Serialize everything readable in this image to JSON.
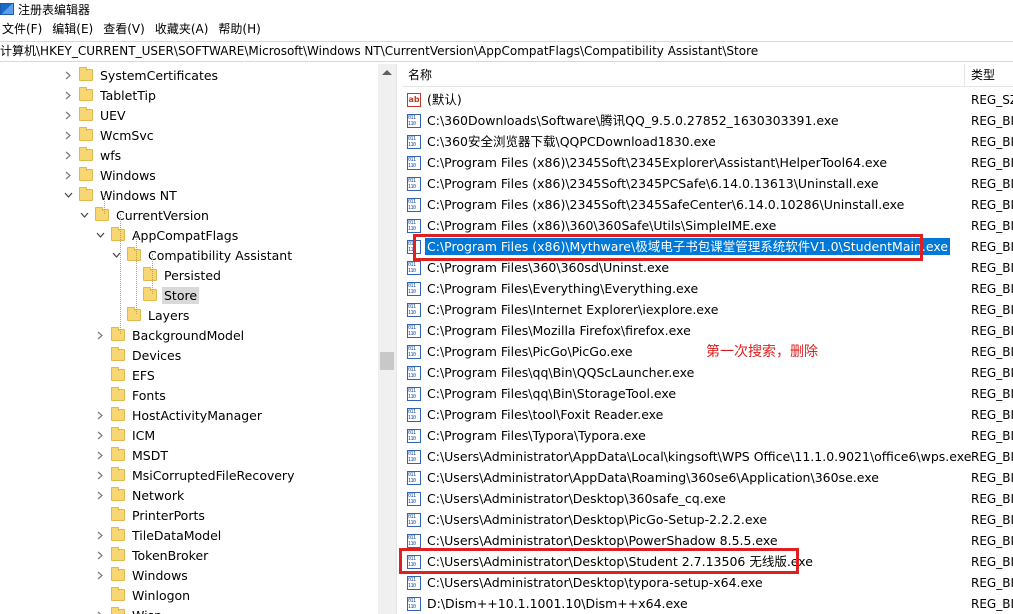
{
  "window": {
    "title": "注册表编辑器"
  },
  "menu": [
    "文件(F)",
    "编辑(E)",
    "查看(V)",
    "收藏夹(A)",
    "帮助(H)"
  ],
  "address": "计算机\\HKEY_CURRENT_USER\\SOFTWARE\\Microsoft\\Windows NT\\CurrentVersion\\AppCompatFlags\\Compatibility Assistant\\Store",
  "tree": [
    {
      "label": "SystemCertificates",
      "expander": "right"
    },
    {
      "label": "TabletTip",
      "expander": "right"
    },
    {
      "label": "UEV",
      "expander": "right"
    },
    {
      "label": "WcmSvc",
      "expander": "right"
    },
    {
      "label": "wfs",
      "expander": "right"
    },
    {
      "label": "Windows",
      "expander": "right"
    },
    {
      "label": "Windows NT",
      "expander": "down"
    },
    {
      "label": "CurrentVersion",
      "expander": "down"
    },
    {
      "label": "AppCompatFlags",
      "expander": "down"
    },
    {
      "label": "Compatibility Assistant",
      "expander": "down"
    },
    {
      "label": "Persisted",
      "expander": "none"
    },
    {
      "label": "Store",
      "expander": "none",
      "selected": true
    },
    {
      "label": "Layers",
      "expander": "none"
    },
    {
      "label": "BackgroundModel",
      "expander": "right"
    },
    {
      "label": "Devices",
      "expander": "none"
    },
    {
      "label": "EFS",
      "expander": "none"
    },
    {
      "label": "Fonts",
      "expander": "none"
    },
    {
      "label": "HostActivityManager",
      "expander": "right"
    },
    {
      "label": "ICM",
      "expander": "right"
    },
    {
      "label": "MSDT",
      "expander": "right"
    },
    {
      "label": "MsiCorruptedFileRecovery",
      "expander": "right"
    },
    {
      "label": "Network",
      "expander": "right"
    },
    {
      "label": "PrinterPorts",
      "expander": "none"
    },
    {
      "label": "TileDataModel",
      "expander": "right"
    },
    {
      "label": "TokenBroker",
      "expander": "right"
    },
    {
      "label": "Windows",
      "expander": "right"
    },
    {
      "label": "Winlogon",
      "expander": "none"
    },
    {
      "label": "Wisp",
      "expander": "right"
    }
  ],
  "list": {
    "columns": {
      "name": "名称",
      "type": "类型"
    },
    "rows": [
      {
        "name": "(默认)",
        "type": "REG_SZ",
        "icon": "ab"
      },
      {
        "name": "C:\\360Downloads\\Software\\腾讯QQ_9.5.0.27852_1630303391.exe",
        "type": "REG_BI",
        "icon": "bin"
      },
      {
        "name": "C:\\360安全浏览器下载\\QQPCDownload1830.exe",
        "type": "REG_BI",
        "icon": "bin"
      },
      {
        "name": "C:\\Program Files (x86)\\2345Soft\\2345Explorer\\Assistant\\HelperTool64.exe",
        "type": "REG_BI",
        "icon": "bin"
      },
      {
        "name": "C:\\Program Files (x86)\\2345Soft\\2345PCSafe\\6.14.0.13613\\Uninstall.exe",
        "type": "REG_BI",
        "icon": "bin"
      },
      {
        "name": "C:\\Program Files (x86)\\2345Soft\\2345SafeCenter\\6.14.0.10286\\Uninstall.exe",
        "type": "REG_BI",
        "icon": "bin"
      },
      {
        "name": "C:\\Program Files (x86)\\360\\360Safe\\Utils\\SimpleIME.exe",
        "type": "REG_BI",
        "icon": "bin"
      },
      {
        "name": "C:\\Program Files (x86)\\Mythware\\极域电子书包课堂管理系统软件V1.0\\StudentMain.exe",
        "type": "REG_BI",
        "icon": "bin",
        "selected": true
      },
      {
        "name": "C:\\Program Files\\360\\360sd\\Uninst.exe",
        "type": "REG_BI",
        "icon": "bin"
      },
      {
        "name": "C:\\Program Files\\Everything\\Everything.exe",
        "type": "REG_BI",
        "icon": "bin"
      },
      {
        "name": "C:\\Program Files\\Internet Explorer\\iexplore.exe",
        "type": "REG_BI",
        "icon": "bin"
      },
      {
        "name": "C:\\Program Files\\Mozilla Firefox\\firefox.exe",
        "type": "REG_BI",
        "icon": "bin"
      },
      {
        "name": "C:\\Program Files\\PicGo\\PicGo.exe",
        "type": "REG_BI",
        "icon": "bin"
      },
      {
        "name": "C:\\Program Files\\qq\\Bin\\QQScLauncher.exe",
        "type": "REG_BI",
        "icon": "bin"
      },
      {
        "name": "C:\\Program Files\\qq\\Bin\\StorageTool.exe",
        "type": "REG_BI",
        "icon": "bin"
      },
      {
        "name": "C:\\Program Files\\tool\\Foxit Reader.exe",
        "type": "REG_BI",
        "icon": "bin"
      },
      {
        "name": "C:\\Program Files\\Typora\\Typora.exe",
        "type": "REG_BI",
        "icon": "bin"
      },
      {
        "name": "C:\\Users\\Administrator\\AppData\\Local\\kingsoft\\WPS Office\\11.1.0.9021\\office6\\wps.exe",
        "type": "REG_BI",
        "icon": "bin"
      },
      {
        "name": "C:\\Users\\Administrator\\AppData\\Roaming\\360se6\\Application\\360se.exe",
        "type": "REG_BI",
        "icon": "bin"
      },
      {
        "name": "C:\\Users\\Administrator\\Desktop\\360safe_cq.exe",
        "type": "REG_BI",
        "icon": "bin"
      },
      {
        "name": "C:\\Users\\Administrator\\Desktop\\PicGo-Setup-2.2.2.exe",
        "type": "REG_BI",
        "icon": "bin"
      },
      {
        "name": "C:\\Users\\Administrator\\Desktop\\PowerShadow 8.5.5.exe",
        "type": "REG_BI",
        "icon": "bin"
      },
      {
        "name": "C:\\Users\\Administrator\\Desktop\\Student 2.7.13506 无线版.exe",
        "type": "REG_BI",
        "icon": "bin"
      },
      {
        "name": "C:\\Users\\Administrator\\Desktop\\typora-setup-x64.exe",
        "type": "REG_BI",
        "icon": "bin"
      },
      {
        "name": "D:\\Dism++10.1.1001.10\\Dism++x64.exe",
        "type": "REG_BI",
        "icon": "bin"
      }
    ]
  },
  "annotation": "第一次搜索，删除",
  "colors": {
    "highlight": "#0078d7",
    "annotation_red": "#e02020"
  }
}
